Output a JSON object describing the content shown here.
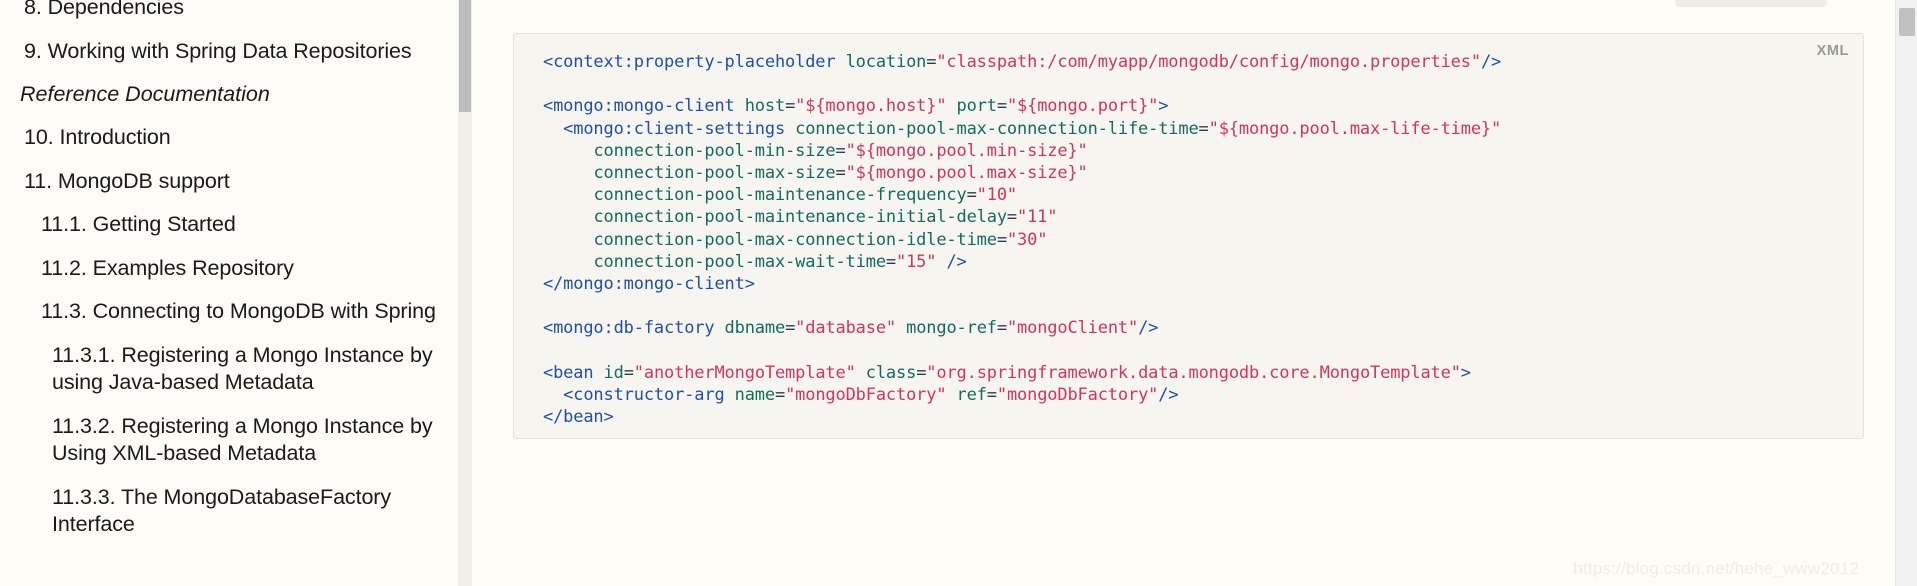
{
  "sidebar": {
    "toc": [
      {
        "label": "8. Dependencies",
        "level": 1,
        "first": true
      },
      {
        "label": "9. Working with Spring Data Repositories",
        "level": 1,
        "first": false
      },
      {
        "label": "Reference Documentation",
        "level": 0,
        "first": false
      },
      {
        "label": "10. Introduction",
        "level": 1,
        "first": false
      },
      {
        "label": "11. MongoDB support",
        "level": 1,
        "first": false
      },
      {
        "label": "11.1. Getting Started",
        "level": 2,
        "first": false
      },
      {
        "label": "11.2. Examples Repository",
        "level": 2,
        "first": false
      },
      {
        "label": "11.3. Connecting to MongoDB with Spring",
        "level": 2,
        "first": false
      },
      {
        "label": "11.3.1. Registering a Mongo Instance by using Java-based Metadata",
        "level": 3,
        "first": false
      },
      {
        "label": "11.3.2. Registering a Mongo Instance by Using XML-based Metadata",
        "level": 3,
        "first": false
      },
      {
        "label": "11.3.3. The MongoDatabaseFactory Interface",
        "level": 3,
        "first": false
      }
    ],
    "scrollbar_name": "sidebar-scrollbar"
  },
  "main": {
    "code_block": {
      "language_label": "XML",
      "lines": [
        [
          {
            "t": "tg",
            "v": "<context:property-placeholder"
          },
          {
            "t": "pn",
            "v": " "
          },
          {
            "t": "tn",
            "v": "location"
          },
          {
            "t": "eq",
            "v": "="
          },
          {
            "t": "st",
            "v": "\"classpath:/com/myapp/mongodb/config/mongo.properties\""
          },
          {
            "t": "tg",
            "v": "/>"
          }
        ],
        [],
        [
          {
            "t": "tg",
            "v": "<mongo:mongo-client"
          },
          {
            "t": "pn",
            "v": " "
          },
          {
            "t": "tn",
            "v": "host"
          },
          {
            "t": "eq",
            "v": "="
          },
          {
            "t": "st",
            "v": "\"${mongo.host}\""
          },
          {
            "t": "pn",
            "v": " "
          },
          {
            "t": "tn",
            "v": "port"
          },
          {
            "t": "eq",
            "v": "="
          },
          {
            "t": "st",
            "v": "\"${mongo.port}\""
          },
          {
            "t": "tg",
            "v": ">"
          }
        ],
        [
          {
            "t": "pn",
            "v": "  "
          },
          {
            "t": "tg",
            "v": "<mongo:client-settings"
          },
          {
            "t": "pn",
            "v": " "
          },
          {
            "t": "tn",
            "v": "connection-pool-max-connection-life-time"
          },
          {
            "t": "eq",
            "v": "="
          },
          {
            "t": "st",
            "v": "\"${mongo.pool.max-life-time}\""
          }
        ],
        [
          {
            "t": "pn",
            "v": "     "
          },
          {
            "t": "tn",
            "v": "connection-pool-min-size"
          },
          {
            "t": "eq",
            "v": "="
          },
          {
            "t": "st",
            "v": "\"${mongo.pool.min-size}\""
          }
        ],
        [
          {
            "t": "pn",
            "v": "     "
          },
          {
            "t": "tn",
            "v": "connection-pool-max-size"
          },
          {
            "t": "eq",
            "v": "="
          },
          {
            "t": "st",
            "v": "\"${mongo.pool.max-size}\""
          }
        ],
        [
          {
            "t": "pn",
            "v": "     "
          },
          {
            "t": "tn",
            "v": "connection-pool-maintenance-frequency"
          },
          {
            "t": "eq",
            "v": "="
          },
          {
            "t": "st",
            "v": "\"10\""
          }
        ],
        [
          {
            "t": "pn",
            "v": "     "
          },
          {
            "t": "tn",
            "v": "connection-pool-maintenance-initial-delay"
          },
          {
            "t": "eq",
            "v": "="
          },
          {
            "t": "st",
            "v": "\"11\""
          }
        ],
        [
          {
            "t": "pn",
            "v": "     "
          },
          {
            "t": "tn",
            "v": "connection-pool-max-connection-idle-time"
          },
          {
            "t": "eq",
            "v": "="
          },
          {
            "t": "st",
            "v": "\"30\""
          }
        ],
        [
          {
            "t": "pn",
            "v": "     "
          },
          {
            "t": "tn",
            "v": "connection-pool-max-wait-time"
          },
          {
            "t": "eq",
            "v": "="
          },
          {
            "t": "st",
            "v": "\"15\""
          },
          {
            "t": "pn",
            "v": " "
          },
          {
            "t": "tg",
            "v": "/>"
          }
        ],
        [
          {
            "t": "tg",
            "v": "</mongo:mongo-client>"
          }
        ],
        [],
        [
          {
            "t": "tg",
            "v": "<mongo:db-factory"
          },
          {
            "t": "pn",
            "v": " "
          },
          {
            "t": "tn",
            "v": "dbname"
          },
          {
            "t": "eq",
            "v": "="
          },
          {
            "t": "st",
            "v": "\"database\""
          },
          {
            "t": "pn",
            "v": " "
          },
          {
            "t": "tn",
            "v": "mongo-ref"
          },
          {
            "t": "eq",
            "v": "="
          },
          {
            "t": "st",
            "v": "\"mongoClient\""
          },
          {
            "t": "tg",
            "v": "/>"
          }
        ],
        [],
        [
          {
            "t": "tg",
            "v": "<bean"
          },
          {
            "t": "pn",
            "v": " "
          },
          {
            "t": "tn",
            "v": "id"
          },
          {
            "t": "eq",
            "v": "="
          },
          {
            "t": "st",
            "v": "\"anotherMongoTemplate\""
          },
          {
            "t": "pn",
            "v": " "
          },
          {
            "t": "tn",
            "v": "class"
          },
          {
            "t": "eq",
            "v": "="
          },
          {
            "t": "st",
            "v": "\"org.springframework.data.mongodb.core.MongoTemplate\""
          },
          {
            "t": "tg",
            "v": ">"
          }
        ],
        [
          {
            "t": "pn",
            "v": "  "
          },
          {
            "t": "tg",
            "v": "<constructor-arg"
          },
          {
            "t": "pn",
            "v": " "
          },
          {
            "t": "tn",
            "v": "name"
          },
          {
            "t": "eq",
            "v": "="
          },
          {
            "t": "st",
            "v": "\"mongoDbFactory\""
          },
          {
            "t": "pn",
            "v": " "
          },
          {
            "t": "tn",
            "v": "ref"
          },
          {
            "t": "eq",
            "v": "="
          },
          {
            "t": "st",
            "v": "\"mongoDbFactory\""
          },
          {
            "t": "tg",
            "v": "/>"
          }
        ],
        [
          {
            "t": "tg",
            "v": "</bean>"
          }
        ]
      ]
    },
    "watermark": "https://blog.csdn.net/hehe_www2012"
  },
  "colors": {
    "page_background": "#fdfcf7",
    "code_background": "#f7f5f0",
    "tag": "#1f4fa8",
    "attribute": "#136b5e",
    "string": "#d5325f",
    "scrollbar_thumb": "#c1c1c1"
  }
}
